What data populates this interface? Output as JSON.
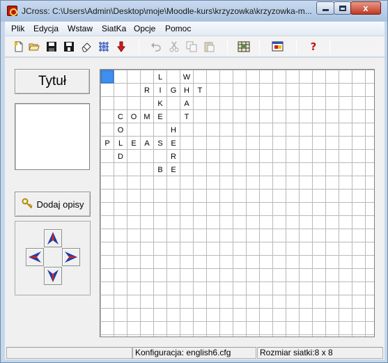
{
  "window": {
    "title": "JCross: C:\\Users\\Admin\\Desktop\\moje\\Moodle-kurs\\krzyzowka\\krzyzowka-m...",
    "close_label": "x"
  },
  "menu": [
    "Plik",
    "Edycja",
    "Wstaw",
    "SiatKa",
    "Opcje",
    "Pomoc"
  ],
  "toolbar": {
    "icons": [
      "new-file-icon",
      "open-folder-icon",
      "save-icon",
      "save-as-icon",
      "eraser-icon",
      "grid-pattern-icon",
      "red-down-arrow-icon",
      "undo-icon",
      "cut-icon",
      "copy-icon",
      "paste-icon",
      "grid-export-icon",
      "web-export-icon",
      "help-icon"
    ],
    "help_label": "?"
  },
  "left_panel": {
    "title_button": "Tytuł",
    "add_descriptions_button": "Dodaj opisy"
  },
  "grid": {
    "selected_cell": [
      0,
      0
    ],
    "letters": [
      {
        "row": 0,
        "col": 4,
        "ch": "L"
      },
      {
        "row": 0,
        "col": 6,
        "ch": "W"
      },
      {
        "row": 1,
        "col": 3,
        "ch": "R"
      },
      {
        "row": 1,
        "col": 4,
        "ch": "I"
      },
      {
        "row": 1,
        "col": 5,
        "ch": "G"
      },
      {
        "row": 1,
        "col": 6,
        "ch": "H"
      },
      {
        "row": 1,
        "col": 7,
        "ch": "T"
      },
      {
        "row": 2,
        "col": 4,
        "ch": "K"
      },
      {
        "row": 2,
        "col": 6,
        "ch": "A"
      },
      {
        "row": 3,
        "col": 1,
        "ch": "C"
      },
      {
        "row": 3,
        "col": 2,
        "ch": "O"
      },
      {
        "row": 3,
        "col": 3,
        "ch": "M"
      },
      {
        "row": 3,
        "col": 4,
        "ch": "E"
      },
      {
        "row": 3,
        "col": 6,
        "ch": "T"
      },
      {
        "row": 4,
        "col": 1,
        "ch": "O"
      },
      {
        "row": 4,
        "col": 5,
        "ch": "H"
      },
      {
        "row": 5,
        "col": 0,
        "ch": "P"
      },
      {
        "row": 5,
        "col": 1,
        "ch": "L"
      },
      {
        "row": 5,
        "col": 2,
        "ch": "E"
      },
      {
        "row": 5,
        "col": 3,
        "ch": "A"
      },
      {
        "row": 5,
        "col": 4,
        "ch": "S"
      },
      {
        "row": 5,
        "col": 5,
        "ch": "E"
      },
      {
        "row": 6,
        "col": 1,
        "ch": "D"
      },
      {
        "row": 6,
        "col": 5,
        "ch": "R"
      },
      {
        "row": 7,
        "col": 4,
        "ch": "B"
      },
      {
        "row": 7,
        "col": 5,
        "ch": "E"
      }
    ],
    "colors": {
      "line": "#b9b9b9",
      "selected": "#3d8ff0",
      "selected_border": "#1d5fb8"
    }
  },
  "status": {
    "config": "Konfiguracja: english6.cfg",
    "size": "Rozmiar siatki:8 x 8"
  }
}
